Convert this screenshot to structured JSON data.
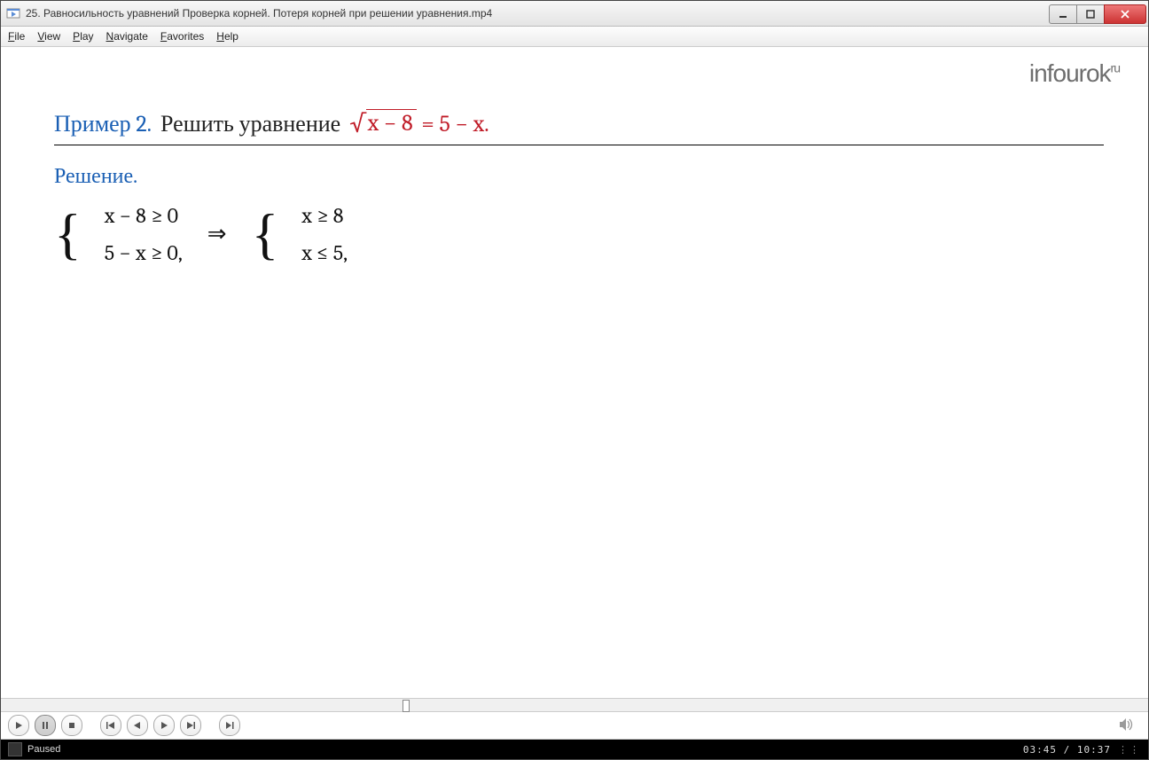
{
  "window": {
    "title": "25. Равносильность уравнений Проверка корней. Потеря корней при решении уравнения.mp4"
  },
  "menu": {
    "file": {
      "hot": "F",
      "rest": "ile"
    },
    "view": {
      "hot": "V",
      "rest": "iew"
    },
    "play": {
      "hot": "P",
      "rest": "lay"
    },
    "nav": {
      "hot": "N",
      "rest": "avigate"
    },
    "fav": {
      "hot": "F",
      "rest": "avorites"
    },
    "help": {
      "hot": "H",
      "rest": "elp"
    }
  },
  "slide": {
    "logo_main": "infourok",
    "logo_sup": "ru",
    "example_label": "Пример 2.",
    "example_text": "Решить уравнение",
    "sqrt_body": "x − 8",
    "eq_rest": " = 5 − x.",
    "solution_label": "Решение.",
    "sys1_a": "x − 8 ≥ 0",
    "sys1_b": "5 − x ≥ 0,",
    "arrow": "⇒",
    "sys2_a": "x ≥ 8",
    "sys2_b": "x ≤ 5,"
  },
  "player": {
    "status": "Paused",
    "time_current": "03:45",
    "time_total": "10:37",
    "time_sep": " / "
  }
}
